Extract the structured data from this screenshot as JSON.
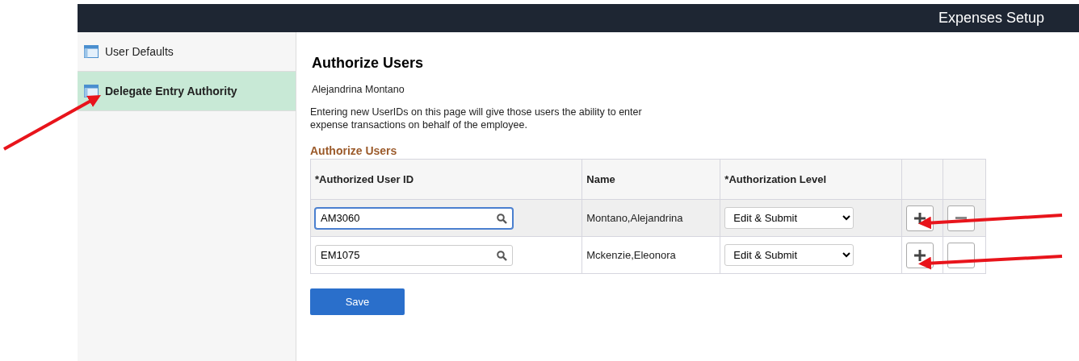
{
  "header": {
    "title": "Expenses Setup"
  },
  "sidebar": {
    "items": [
      {
        "label": "User Defaults",
        "selected": false
      },
      {
        "label": "Delegate Entry Authority",
        "selected": true
      }
    ]
  },
  "page": {
    "title": "Authorize Users",
    "employee": "Alejandrina Montano",
    "description": "Entering new UserIDs on this page will give those users the ability to enter expense transactions on behalf of the employee."
  },
  "grid": {
    "title": "Authorize Users",
    "columns": [
      "*Authorized User ID",
      "Name",
      "*Authorization Level"
    ],
    "rows": [
      {
        "user_id": "AM3060",
        "name": "Montano,Alejandrina",
        "level": "Edit & Submit",
        "selected": true,
        "focused": true,
        "delete_disabled": false
      },
      {
        "user_id": "EM1075",
        "name": "Mckenzie,Eleonora",
        "level": "Edit & Submit",
        "selected": false,
        "focused": false,
        "delete_disabled": true
      }
    ]
  },
  "save_button": "Save",
  "annotations": [
    {
      "kind": "arrow"
    },
    {
      "kind": "arrow"
    },
    {
      "kind": "arrow"
    }
  ]
}
